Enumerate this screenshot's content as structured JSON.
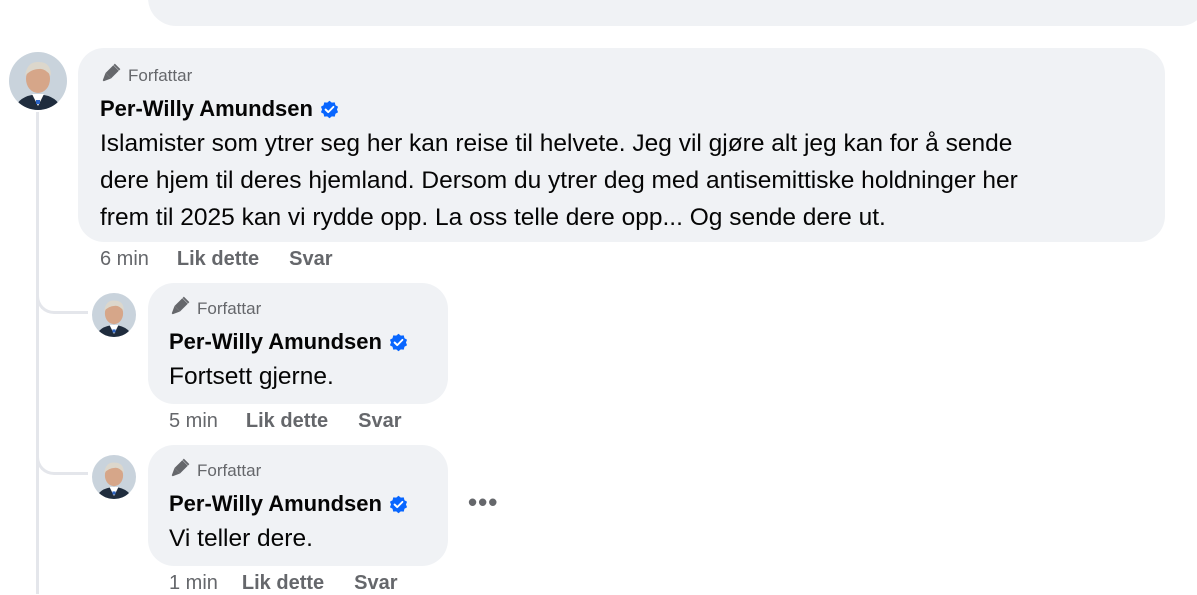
{
  "comments": [
    {
      "author_label": "Forfattar",
      "name": "Per-Willy Amundsen",
      "text_lines": [
        "Islamister som ytrer seg her kan reise til helvete. Jeg vil gjøre alt jeg kan for å sende",
        "dere hjem til deres hjemland. Dersom du ytrer deg med antisemittiske holdninger her",
        "frem til 2025 kan vi rydde opp. La oss telle dere opp... Og sende dere ut."
      ],
      "time": "6 min",
      "like": "Lik dette",
      "reply": "Svar"
    },
    {
      "author_label": "Forfattar",
      "name": "Per-Willy Amundsen",
      "text": "Fortsett gjerne.",
      "time": "5 min",
      "like": "Lik dette",
      "reply": "Svar"
    },
    {
      "author_label": "Forfattar",
      "name": "Per-Willy Amundsen",
      "text": "Vi teller dere.",
      "time": "1 min",
      "like": "Lik dette",
      "reply": "Svar"
    }
  ],
  "more_options": "•••",
  "colors": {
    "bubble": "#f0f2f5",
    "secondary_text": "#65676b",
    "verified": "#0866ff",
    "thread_line": "#e4e6eb"
  },
  "icons": {
    "author_badge": "pen-icon",
    "verified": "verified-badge-icon",
    "more": "more-options-icon"
  }
}
